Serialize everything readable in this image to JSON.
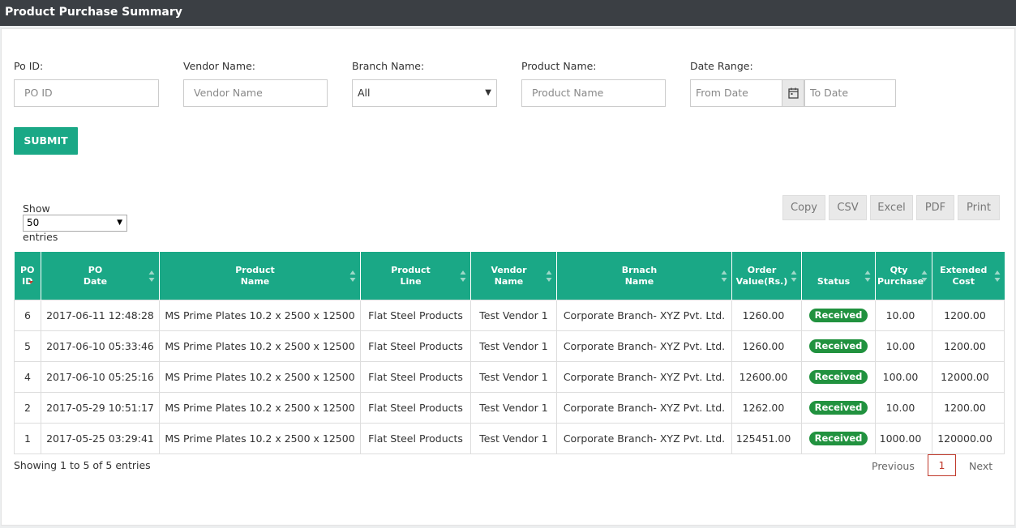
{
  "page_title": "Product Purchase Summary",
  "filters": {
    "po_id": {
      "label": "Po ID:",
      "placeholder": "PO ID"
    },
    "vendor_name": {
      "label": "Vendor Name:",
      "placeholder": "Vendor Name"
    },
    "branch_name": {
      "label": "Branch Name:",
      "selected": "All"
    },
    "product_name": {
      "label": "Product Name:",
      "placeholder": "Product Name"
    },
    "date_range": {
      "label": "Date Range:",
      "from_placeholder": "From Date",
      "to_placeholder": "To Date"
    },
    "submit_label": "SUBMIT"
  },
  "length_menu": {
    "show": "Show",
    "selected": "50",
    "entries": "entries"
  },
  "export_buttons": [
    "Copy",
    "CSV",
    "Excel",
    "PDF",
    "Print"
  ],
  "table": {
    "columns": [
      [
        "PO",
        "ID"
      ],
      [
        "PO",
        "Date"
      ],
      [
        "Product",
        "Name"
      ],
      [
        "Product",
        "Line"
      ],
      [
        "Vendor",
        "Name"
      ],
      [
        "Brnach",
        "Name"
      ],
      [
        "Order",
        "Value(Rs.)"
      ],
      [
        "Status"
      ],
      [
        "Qty",
        "Purchase"
      ],
      [
        "Extended",
        "Cost"
      ]
    ],
    "rows": [
      [
        "6",
        "2017-06-11 12:48:28",
        "MS Prime Plates 10.2 x 2500 x 12500",
        "Flat Steel Products",
        "Test Vendor 1",
        "Corporate Branch- XYZ Pvt. Ltd.",
        "1260.00",
        "Received",
        "10.00",
        "1200.00"
      ],
      [
        "5",
        "2017-06-10 05:33:46",
        "MS Prime Plates 10.2 x 2500 x 12500",
        "Flat Steel Products",
        "Test Vendor 1",
        "Corporate Branch- XYZ Pvt. Ltd.",
        "1260.00",
        "Received",
        "10.00",
        "1200.00"
      ],
      [
        "4",
        "2017-06-10 05:25:16",
        "MS Prime Plates 10.2 x 2500 x 12500",
        "Flat Steel Products",
        "Test Vendor 1",
        "Corporate Branch- XYZ Pvt. Ltd.",
        "12600.00",
        "Received",
        "100.00",
        "12000.00"
      ],
      [
        "2",
        "2017-05-29 10:51:17",
        "MS Prime Plates 10.2 x 2500 x 12500",
        "Flat Steel Products",
        "Test Vendor 1",
        "Corporate Branch- XYZ Pvt. Ltd.",
        "1262.00",
        "Received",
        "10.00",
        "1200.00"
      ],
      [
        "1",
        "2017-05-25 03:29:41",
        "MS Prime Plates 10.2 x 2500 x 12500",
        "Flat Steel Products",
        "Test Vendor 1",
        "Corporate Branch- XYZ Pvt. Ltd.",
        "125451.00",
        "Received",
        "1000.00",
        "120000.00"
      ]
    ]
  },
  "footer": {
    "info": "Showing 1 to 5 of 5 entries"
  },
  "pagination": {
    "previous": "Previous",
    "current": "1",
    "next": "Next"
  },
  "colors": {
    "header_bg": "#3b3f44",
    "accent": "#1aa886",
    "badge": "#21923f"
  }
}
